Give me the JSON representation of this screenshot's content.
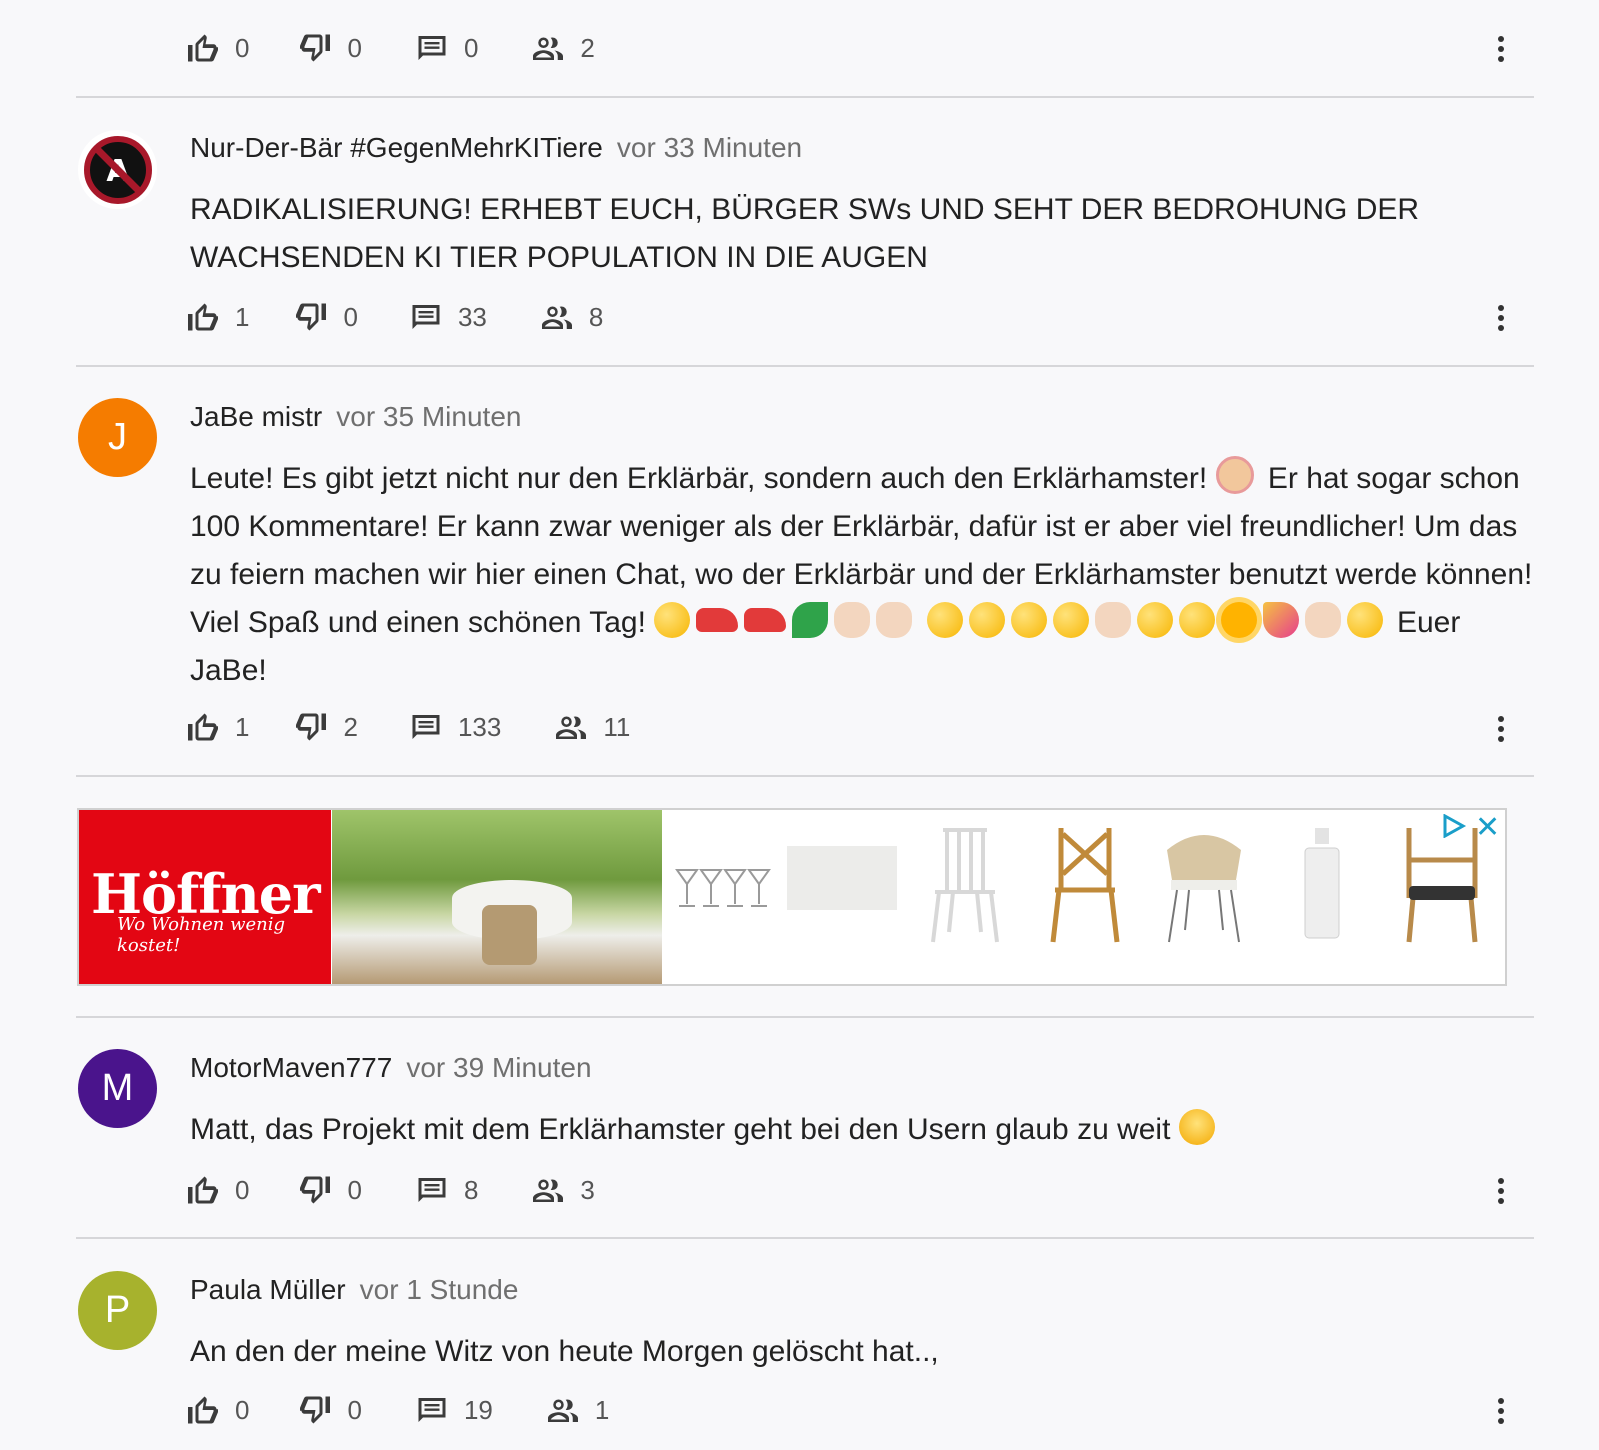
{
  "comments": [
    {
      "author": "",
      "time": "",
      "body": "",
      "likes": "0",
      "dislikes": "0",
      "replies": "0",
      "participants": "2"
    },
    {
      "author": "Nur-Der-Bär #GegenMehrKITiere",
      "time": "vor 33 Minuten",
      "avatar_text": "AI",
      "body": "RADIKALISIERUNG! ERHEBT EUCH, BÜRGER SWs UND SEHT DER BEDROHUNG DER WACHSENDEN KI TIER POPULATION IN DIE AUGEN",
      "likes": "1",
      "dislikes": "0",
      "replies": "33",
      "participants": "8"
    },
    {
      "author": "JaBe mistr",
      "time": "vor 35 Minuten",
      "avatar_letter": "J",
      "avatar_color": "#f57c00",
      "body_part1": "Leute! Es gibt jetzt nicht nur den Erklärbär, sondern auch den Erklärhamster!",
      "body_part2": "Er hat sogar schon 100 Kommentare! Er kann zwar weniger als der Erklärbär, dafür ist er aber viel freundlicher! Um das zu feiern machen wir hier einen Chat, wo der Erklärbär und der Erklärhamster benutzt werde können! Viel Spaß und einen schönen Tag!",
      "body_part3": "Euer JaBe!",
      "likes": "1",
      "dislikes": "2",
      "replies": "133",
      "participants": "11"
    },
    {
      "author": "MotorMaven777",
      "time": "vor 39 Minuten",
      "avatar_letter": "M",
      "avatar_color": "#4a148c",
      "body": "Matt, das Projekt mit dem Erklärhamster geht bei den Usern glaub zu weit",
      "likes": "0",
      "dislikes": "0",
      "replies": "8",
      "participants": "3"
    },
    {
      "author": "Paula Müller",
      "time": "vor 1 Stunde",
      "avatar_letter": "P",
      "avatar_color": "#a7b22d",
      "body": "An den der meine Witz von heute Morgen gelöscht hat..,",
      "likes": "0",
      "dislikes": "0",
      "replies": "19",
      "participants": "1"
    }
  ],
  "ad": {
    "brand": "Höffner",
    "tagline": "Wo Wohnen wenig kostet!",
    "close": "✕",
    "brand_color": "#e30613"
  },
  "icons": {
    "like": "thumb-up-icon",
    "dislike": "thumb-down-icon",
    "replies": "comment-icon",
    "participants": "people-icon",
    "more": "more-vert-icon"
  }
}
